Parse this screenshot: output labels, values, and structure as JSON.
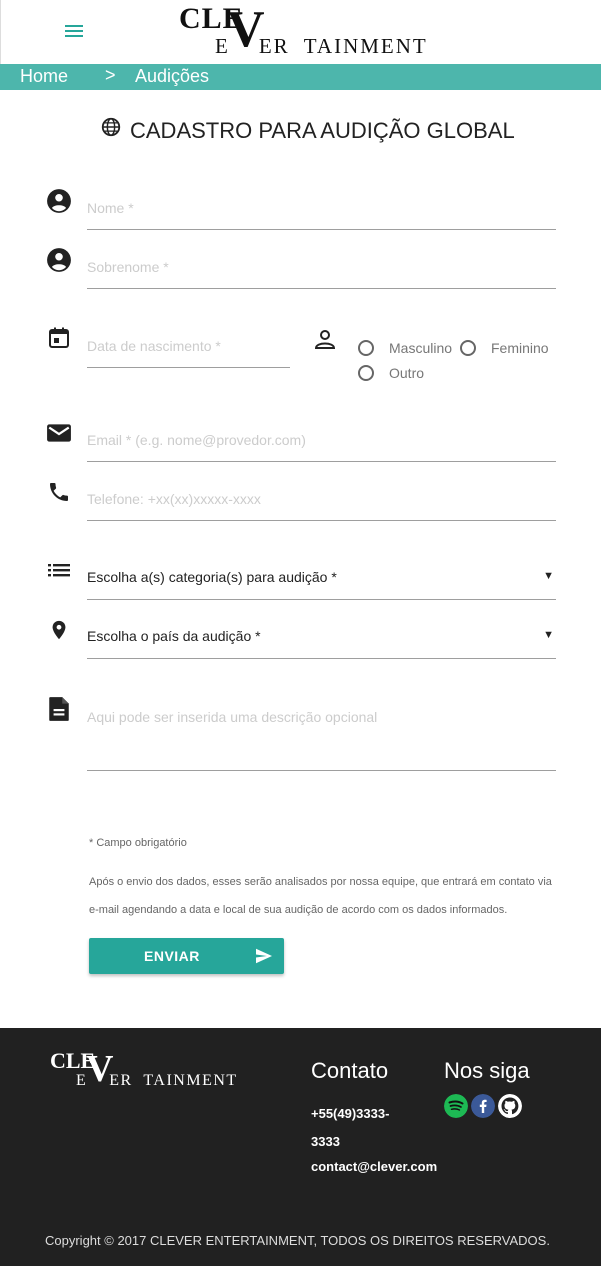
{
  "header": {
    "logo_line1": "CLE",
    "logo_mark": "V",
    "logo_line2": "E    ER  TAINMENT",
    "menu_icon": "hamburger-icon"
  },
  "breadcrumb": {
    "home": "Home",
    "separator": ">",
    "current": "Audições"
  },
  "form": {
    "title": "CADASTRO PARA AUDIÇÃO GLOBAL",
    "first_name_placeholder": "Nome *",
    "last_name_placeholder": "Sobrenome *",
    "birthdate_placeholder": "Data de nascimento *",
    "gender_options": [
      "Masculino",
      "Feminino",
      "Outro"
    ],
    "email_placeholder": "Email * (e.g. nome@provedor.com)",
    "phone_placeholder": "Telefone: +xx(xx)xxxxx-xxxx",
    "category_select": "Escolha a(s) categoria(s) para audição *",
    "country_select": "Escolha o país da audição *",
    "description_placeholder": "Aqui pode ser inserida uma descrição opcional",
    "required_note": "* Campo obrigatório",
    "info_text": "Após o envio dos dados, esses serão analisados por nossa equipe, que entrará em contato via e-mail agendando a data e local de sua audição de acordo com os dados informados.",
    "submit_label": "ENVIAR"
  },
  "footer": {
    "logo_line1": "CLE",
    "logo_mark": "V",
    "logo_line2": "E    ER  TAINMENT",
    "contact_title": "Contato",
    "phone": "+55(49)3333-3333",
    "email": "contact@clever.com",
    "follow_title": "Nos siga",
    "social_icons": [
      "spotify-icon",
      "facebook-icon",
      "github-icon"
    ],
    "copyright": "Copyright © 2017 CLEVER ENTERTAINMENT, TODOS OS DIREITOS RESERVADOS."
  },
  "colors": {
    "accent": "#26a69a",
    "breadcrumb_bg": "#4db6ac",
    "footer_bg": "#212121",
    "spotify": "#1db954",
    "facebook": "#3b5998"
  }
}
